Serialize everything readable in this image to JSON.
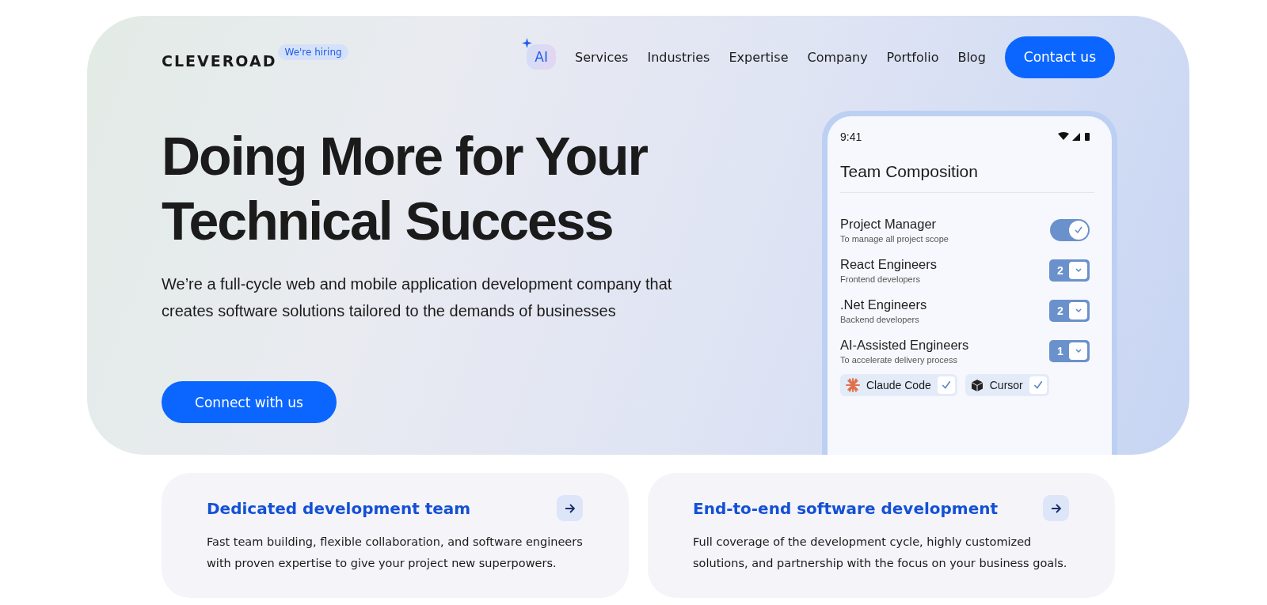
{
  "header": {
    "logo": "CLEVEROAD",
    "hiring_badge": "We're hiring",
    "nav": [
      {
        "label": "AI",
        "kind": "ai"
      },
      {
        "label": "Services",
        "kind": "link"
      },
      {
        "label": "Industries",
        "kind": "link"
      },
      {
        "label": "Expertise",
        "kind": "link"
      },
      {
        "label": "Company",
        "kind": "link"
      },
      {
        "label": "Portfolio",
        "kind": "link"
      },
      {
        "label": "Blog",
        "kind": "link"
      }
    ],
    "cta": "Contact us"
  },
  "hero": {
    "title_lines": [
      "Doing More for Your",
      "Technical Success"
    ],
    "subtitle": "We’re a full-cycle web and mobile application development company that creates software solutions tailored to the demands of businesses",
    "button": "Connect with us"
  },
  "phone": {
    "time": "9:41",
    "title": "Team Composition",
    "roles": [
      {
        "kind": "toggle",
        "name": "Project Manager",
        "note": "To manage all project scope",
        "on": true
      },
      {
        "kind": "counter",
        "name": "React Engineers",
        "note": "Frontend developers",
        "count": "2"
      },
      {
        "kind": "counter",
        "name": ".Net Engineers",
        "note": "Backend developers",
        "count": "2"
      },
      {
        "kind": "counter",
        "name": "AI-Assisted Engineers",
        "note": "To accelerate delivery process",
        "count": "1"
      }
    ],
    "tools": [
      {
        "name": "Claude Code",
        "kind": "burst",
        "checked": true
      },
      {
        "name": "Cursor",
        "kind": "cube",
        "checked": true
      }
    ]
  },
  "cards": [
    {
      "title": "Dedicated development team",
      "text": "Fast team building, flexible collaboration, and software engineers with proven expertise to give your project new superpowers."
    },
    {
      "title": "End-to-end software development",
      "text": "Full coverage of the development cycle, highly customized solutions, and partnership with the focus on your business goals."
    }
  ]
}
